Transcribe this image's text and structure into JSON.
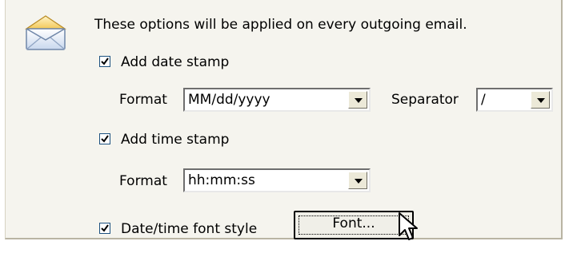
{
  "intro": "These options will be applied on every outgoing email.",
  "date_stamp": {
    "checkbox_label": "Add date stamp",
    "checked": true,
    "format_label": "Format",
    "format_value": "MM/dd/yyyy",
    "separator_label": "Separator",
    "separator_value": "/"
  },
  "time_stamp": {
    "checkbox_label": "Add time stamp",
    "checked": true,
    "format_label": "Format",
    "format_value": "hh:mm:ss"
  },
  "font_style": {
    "checkbox_label": "Date/time font style",
    "checked": true,
    "button_label": "Font..."
  },
  "icons": {
    "envelope": "envelope-icon",
    "cursor": "mouse-pointer-icon"
  },
  "colors": {
    "panel_bg": "#f5f4ee",
    "check_border": "#1c5180",
    "combo_border": "#7f9db9"
  }
}
